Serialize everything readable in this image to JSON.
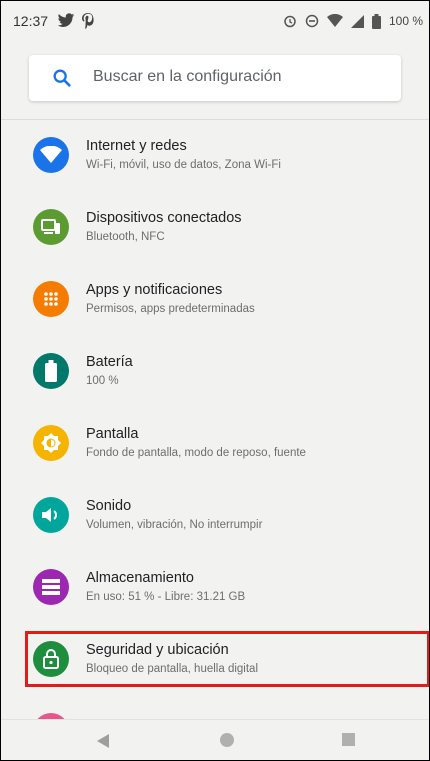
{
  "status": {
    "time": "12:37",
    "battery_percent": "100 %",
    "left_icons": [
      "twitter-icon",
      "pinterest-icon"
    ],
    "right_icons": [
      "alarm-icon",
      "do-not-disturb-icon",
      "wifi-icon",
      "signal-icon",
      "battery-icon"
    ]
  },
  "search": {
    "placeholder": "Buscar en la configuración"
  },
  "settings": {
    "items": [
      {
        "title": "Internet y redes",
        "subtitle": "Wi-Fi, móvil, uso de datos, Zona Wi-Fi",
        "icon": "wifi-icon",
        "color": "#1a73e8"
      },
      {
        "title": "Dispositivos conectados",
        "subtitle": "Bluetooth, NFC",
        "icon": "connected-devices-icon",
        "color": "#5c9b32"
      },
      {
        "title": "Apps y notificaciones",
        "subtitle": "Permisos, apps predeterminadas",
        "icon": "apps-icon",
        "color": "#f57c00"
      },
      {
        "title": "Batería",
        "subtitle": "100 %",
        "icon": "battery-icon",
        "color": "#00796b"
      },
      {
        "title": "Pantalla",
        "subtitle": "Fondo de pantalla, modo de reposo, fuente",
        "icon": "brightness-icon",
        "color": "#f4b400"
      },
      {
        "title": "Sonido",
        "subtitle": "Volumen, vibración, No interrumpir",
        "icon": "volume-icon",
        "color": "#00a69c"
      },
      {
        "title": "Almacenamiento",
        "subtitle": "En uso: 51 % - Libre: 31.21 GB",
        "icon": "storage-icon",
        "color": "#9c27b0"
      },
      {
        "title": "Seguridad y ubicación",
        "subtitle": "Bloqueo de pantalla, huella digital",
        "icon": "lock-icon",
        "color": "#1e8e3e"
      }
    ]
  },
  "navbar": {
    "buttons": [
      "back-icon",
      "home-icon",
      "recents-icon"
    ]
  }
}
